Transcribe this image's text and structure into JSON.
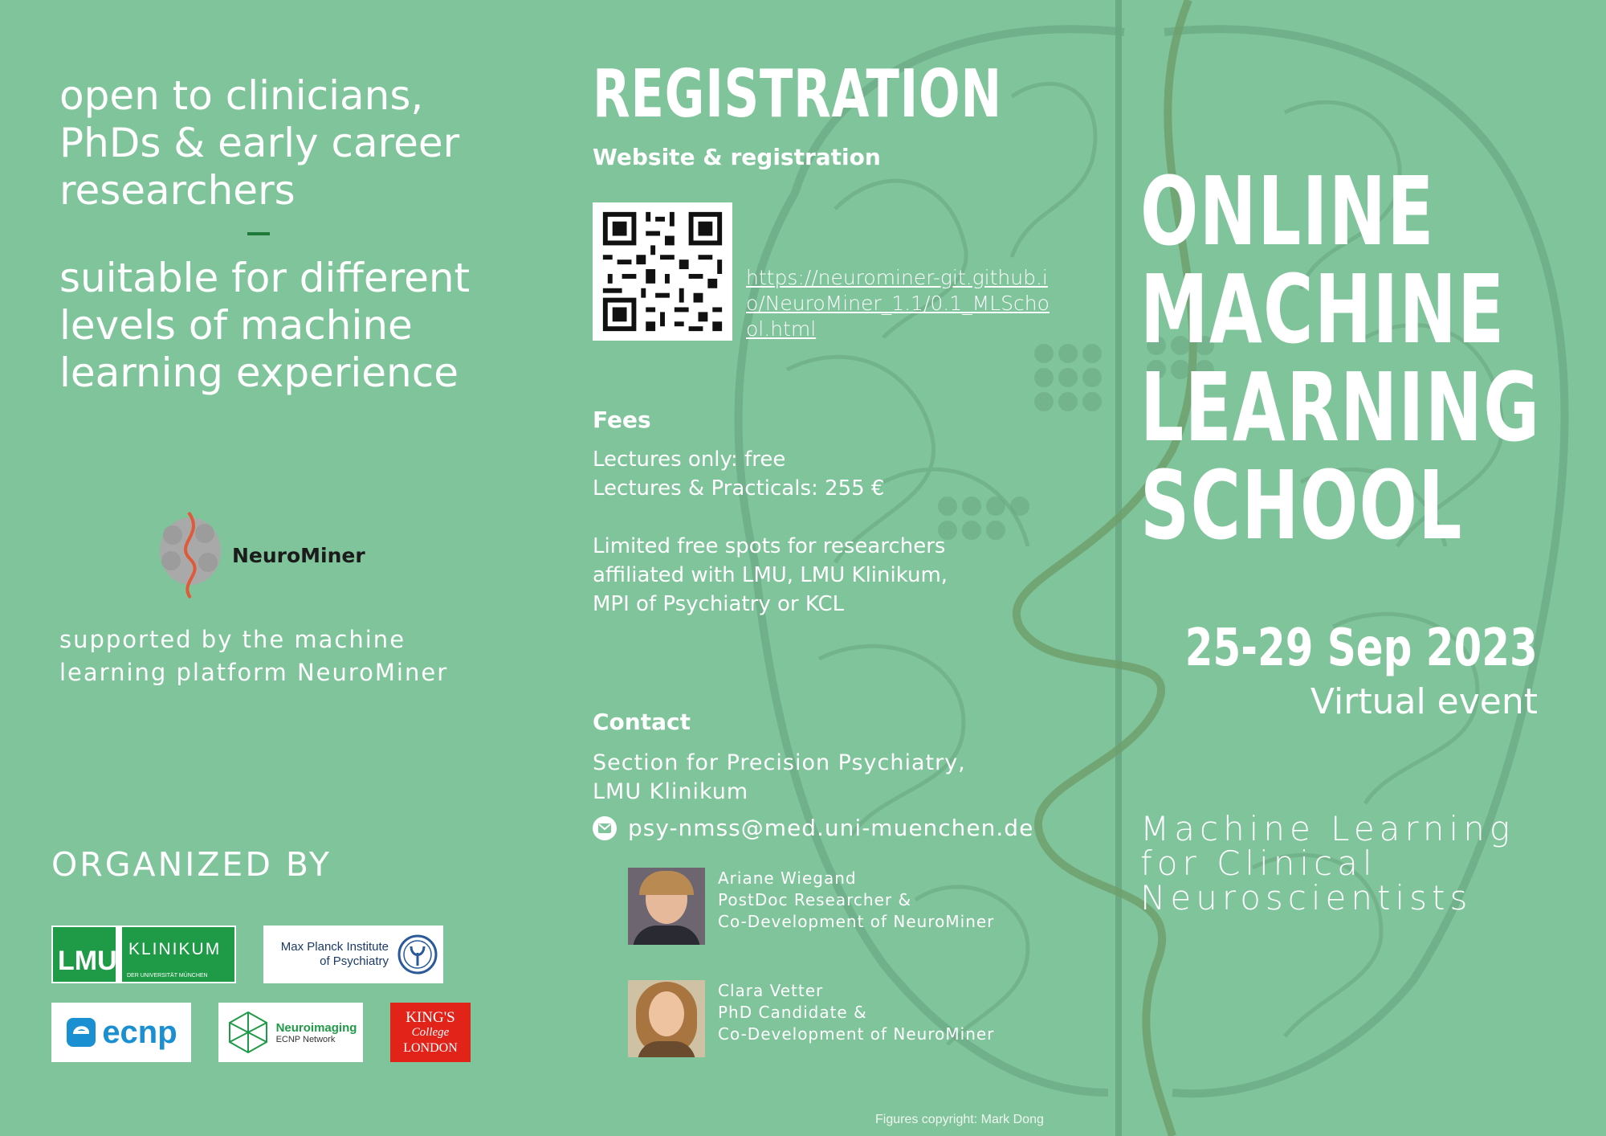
{
  "audience": {
    "line1": "open to clinicians, PhDs & early career researchers",
    "separator": "–",
    "line2": "suitable for different levels of machine learning experience"
  },
  "neurominer_logo": {
    "name": "NeuroMiner"
  },
  "supported": "supported by the machine learning platform NeuroMiner",
  "organized": {
    "heading": "ORGANIZED BY",
    "logos": {
      "lmu": "LMU",
      "klinikum": "KLINIKUM",
      "klinikum_sub": "DER UNIVERSITÄT MÜNCHEN",
      "mpi": "Max Planck Institute of Psychiatry",
      "ecnp": "ecnp",
      "neuroimaging": "Neuroimaging",
      "neuroimaging_sub": "ECNP Network",
      "kings_line1": "KING'S",
      "kings_line2": "College",
      "kings_line3": "LONDON"
    }
  },
  "registration": {
    "title": "REGISTRATION",
    "website_heading": "Website & registration",
    "url": "https://neurominer-git.github.io/NeuroMiner_1.1/0.1_MLSchool.html"
  },
  "fees": {
    "heading": "Fees",
    "lectures_only": "Lectures only: free",
    "lectures_practicals": "Lectures & Practicals: 255 €",
    "limited": "Limited free spots for researchers affiliated with LMU, LMU Klinikum, MPI of Psychiatry or KCL"
  },
  "contact": {
    "heading": "Contact",
    "section": "Section for Precision Psychiatry, LMU Klinikum",
    "email": "psy-nmss@med.uni-muenchen.de",
    "email_icon": "mail-icon",
    "people": [
      {
        "name": "Ariane Wiegand",
        "role": "PostDoc Researcher &",
        "role2": "Co-Development of NeuroMiner"
      },
      {
        "name": "Clara Vetter",
        "role": "PhD Candidate &",
        "role2": "Co-Development of NeuroMiner"
      }
    ]
  },
  "event": {
    "title_lines": [
      "ONLINE",
      "MACHINE",
      "LEARNING",
      "SCHOOL"
    ],
    "dates": "25-29 Sep 2023",
    "format": "Virtual event",
    "subtitle": "Machine Learning for Clinical Neuroscientists"
  },
  "copyright": "Figures copyright: Mark Dong",
  "colors": {
    "background": "#7fc49a",
    "accent_green": "#1f7a3a",
    "lmu_green": "#1f9a47",
    "kcl_red": "#e2231a"
  }
}
